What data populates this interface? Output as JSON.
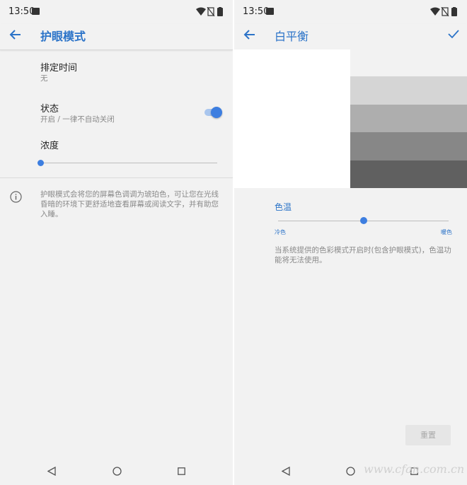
{
  "status_bar": {
    "time": "13:50"
  },
  "left": {
    "title": "护眼模式",
    "schedule": {
      "title": "排定时间",
      "value": "无"
    },
    "status": {
      "title": "状态",
      "value": "开启 / 一律不自动关闭",
      "enabled": true
    },
    "intensity": {
      "title": "浓度",
      "level": 0.0
    },
    "info": "护眼模式会将您的屏幕色调调为琥珀色，可让您在光线昏暗的环境下更舒适地查看屏幕或阅读文字，并有助您入睡。"
  },
  "right": {
    "title": "白平衡",
    "preview_grays": [
      "#d5d5d5",
      "#aeaeae",
      "#878787",
      "#606060"
    ],
    "color_temp": {
      "label": "色温",
      "cold": "冷色",
      "warm": "暖色",
      "level": 0.5
    },
    "note": "当系统提供的色彩模式开启时(包含护眼模式)，色温功能将无法使用。",
    "reset_label": "重置"
  },
  "watermark": "www.cfan.com.cn",
  "colors": {
    "accent": "#2b73c8",
    "toggle_on": "#3d7ee0",
    "background": "#f2f2f2"
  },
  "icons": [
    "back-arrow-icon",
    "wifi-icon",
    "no-sim-icon",
    "battery-icon",
    "image-icon",
    "info-icon",
    "check-icon",
    "nav-back-icon",
    "nav-home-icon",
    "nav-recents-icon"
  ]
}
